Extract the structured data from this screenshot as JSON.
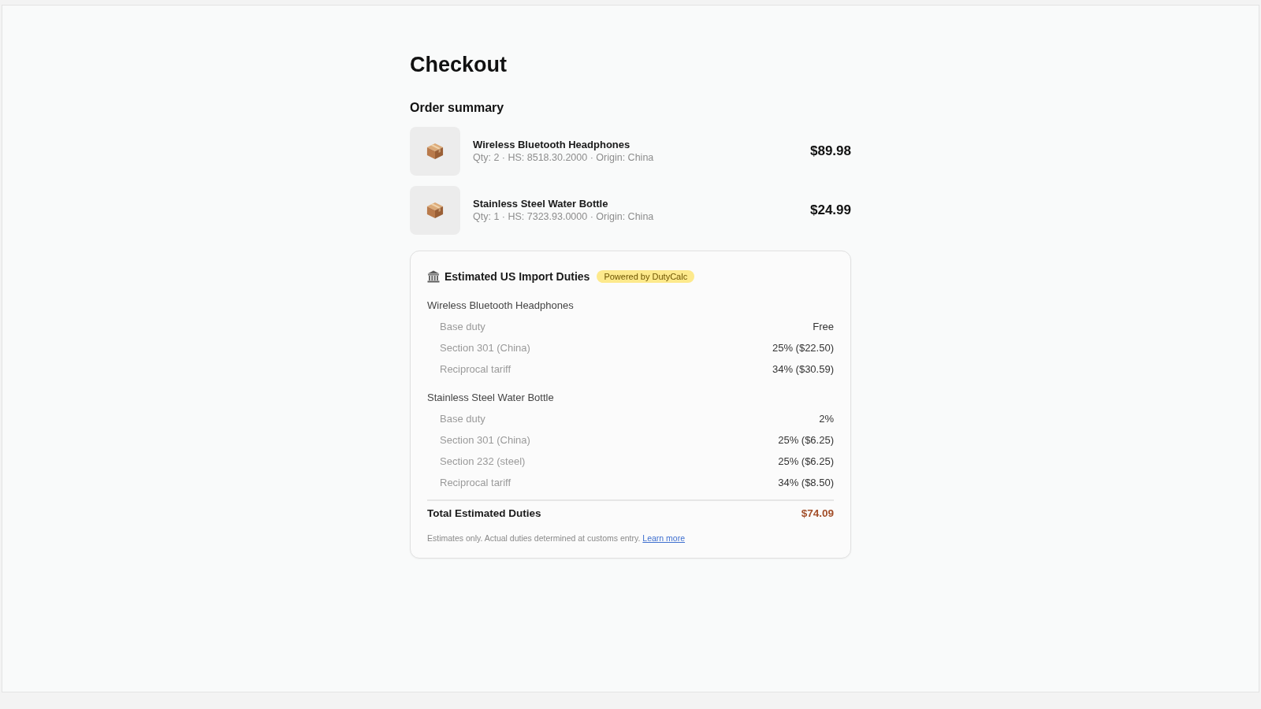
{
  "page": {
    "title": "Checkout"
  },
  "order_summary": {
    "heading": "Order summary",
    "items": [
      {
        "name": "Wireless Bluetooth Headphones",
        "details": "Qty: 2 · HS: 8518.30.2000 · Origin: China",
        "price": "$89.98"
      },
      {
        "name": "Stainless Steel Water Bottle",
        "details": "Qty: 1 · HS: 7323.93.0000 · Origin: China",
        "price": "$24.99"
      }
    ]
  },
  "import_duties": {
    "title": "Estimated US Import Duties",
    "badge": "Powered by DutyCalc",
    "groups": [
      {
        "product": "Wireless Bluetooth Headphones",
        "lines": [
          {
            "label": "Base duty",
            "value": "Free"
          },
          {
            "label": "Section 301 (China)",
            "value": "25% ($22.50)"
          },
          {
            "label": "Reciprocal tariff",
            "value": "34% ($30.59)"
          }
        ]
      },
      {
        "product": "Stainless Steel Water Bottle",
        "lines": [
          {
            "label": "Base duty",
            "value": "2%"
          },
          {
            "label": "Section 301 (China)",
            "value": "25% ($6.25)"
          },
          {
            "label": "Section 232 (steel)",
            "value": "25% ($6.25)"
          },
          {
            "label": "Reciprocal tariff",
            "value": "34% ($8.50)"
          }
        ]
      }
    ],
    "total": {
      "label": "Total Estimated Duties",
      "value": "$74.09"
    },
    "note": "Estimates only. Actual duties determined at customs entry.",
    "link": "Learn more"
  }
}
